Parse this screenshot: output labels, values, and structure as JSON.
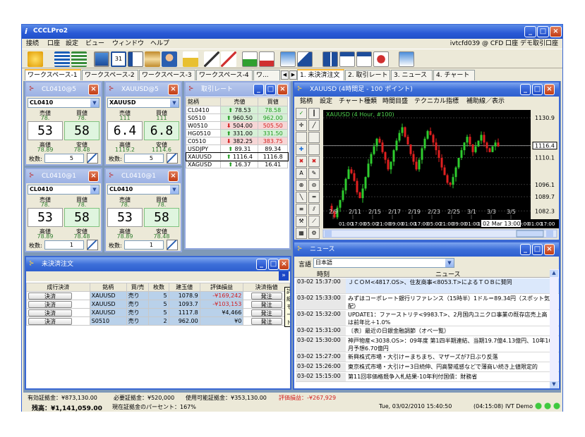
{
  "app": {
    "title": "CCCLPro2",
    "account_info": "ivtcfd039 @ CFD 口座 デモ取引口座"
  },
  "menu": [
    "接続",
    "口座",
    "設定",
    "ビュー",
    "ウィンドウ",
    "ヘルプ"
  ],
  "workspace_tabs": [
    "ワークスペース-1",
    "ワークスペース-2",
    "ワークスペース-3",
    "ワークスペース-4",
    "ワ..."
  ],
  "panel_tabs": [
    "1. 未決済注文",
    "2. 取引レート",
    "3. ニュース",
    "4. チャート"
  ],
  "quote_panels": [
    {
      "title": "CL0410@5",
      "symbol": "CL0410",
      "sell_label": "売値",
      "buy_label": "買値",
      "sell_small": "78.",
      "buy_small": "78.",
      "sell_big": "53",
      "buy_big": "58",
      "high_label": "高値",
      "low_label": "安値",
      "high": "78.89",
      "low": "78.48",
      "qty_label": "枚数:",
      "qty": "5"
    },
    {
      "title": "XAUUSD@5",
      "symbol": "XAUUSD",
      "sell_label": "売値",
      "buy_label": "買値",
      "sell_small": "111",
      "buy_small": "111",
      "sell_big": "6.4",
      "buy_big": "6.8",
      "high_label": "高値",
      "low_label": "安値",
      "high": "1119.2",
      "low": "1114.6",
      "qty_label": "枚数:",
      "qty": "5"
    },
    {
      "title": "CL0410@1",
      "symbol": "CL0410",
      "sell_label": "売値",
      "buy_label": "買値",
      "sell_small": "78.",
      "buy_small": "78.",
      "sell_big": "53",
      "buy_big": "58",
      "high_label": "高値",
      "low_label": "安値",
      "high": "78.89",
      "low": "78.48",
      "qty_label": "枚数:",
      "qty": "1"
    },
    {
      "title": "CL0410@1",
      "symbol": "CL0410",
      "sell_label": "売値",
      "buy_label": "買値",
      "sell_small": "78.",
      "buy_small": "78.",
      "sell_big": "53",
      "buy_big": "58",
      "high_label": "高値",
      "low_label": "安値",
      "high": "78.89",
      "low": "78.48",
      "qty_label": "枚数:",
      "qty": "1"
    }
  ],
  "rates": {
    "title": "取引レート",
    "headers": [
      "銘柄",
      "売値",
      "買値"
    ],
    "rows": [
      {
        "sym": "CL0410",
        "sell": "78.53",
        "buy": "78.58",
        "dir": "up"
      },
      {
        "sym": "S0510",
        "sell": "960.50",
        "buy": "962.00",
        "dir": "up"
      },
      {
        "sym": "W0510",
        "sell": "504.00",
        "buy": "505.50",
        "dir": "down"
      },
      {
        "sym": "HG0510",
        "sell": "331.00",
        "buy": "331.50",
        "dir": "up"
      },
      {
        "sym": "C0510",
        "sell": "382.25",
        "buy": "383.75",
        "dir": "down"
      },
      {
        "sym": "USDJPY",
        "sell": "89.31",
        "buy": "89.34",
        "dir": "up"
      },
      {
        "sym": "XAUUSD",
        "sell": "1116.4",
        "buy": "1116.8",
        "dir": "up"
      },
      {
        "sym": "XAGUSD",
        "sell": "16.37",
        "buy": "16.41",
        "dir": "up"
      }
    ]
  },
  "chart": {
    "title": "XAUUSD (4時間足 - 100 ポイント)",
    "menu": [
      "銘柄",
      "設定",
      "チャート種類",
      "時間目盛",
      "テクニカル指標",
      "補助線／表示"
    ],
    "label": "XAUUSD (4 Hour, #100)",
    "y_ticks": [
      "1130.9",
      "1116.4",
      "1110.1",
      "1096.1",
      "1089.7",
      "1082.3"
    ],
    "date_ticks": [
      "2/9",
      "2/11",
      "2/15",
      "2/17",
      "2/19",
      "2/23",
      "2/25",
      "3/1",
      "3/3",
      "3/5"
    ],
    "time_ticks": [
      "01:00",
      "17:00",
      "05:00",
      "21:00",
      "09:00",
      "01:00",
      "17:00",
      "05:00",
      "21:00",
      "09:00",
      "01:00",
      "17:00",
      "05:00",
      "21:00",
      "09:00",
      "01:00",
      "17:00"
    ],
    "current_price": "1116.4",
    "cursor_time": "02 Mar 13:00"
  },
  "chart_data": {
    "type": "candlestick",
    "title": "XAUUSD (4 Hour, #100)",
    "ylim": [
      1078,
      1135
    ],
    "close_series": [
      1085,
      1082,
      1079,
      1084,
      1088,
      1093,
      1099,
      1104,
      1102,
      1098,
      1092,
      1089,
      1094,
      1100,
      1107,
      1112,
      1116,
      1120,
      1118,
      1113,
      1109,
      1104,
      1108,
      1114,
      1119,
      1123,
      1126,
      1121,
      1117,
      1112,
      1108,
      1104,
      1109,
      1115,
      1120,
      1124,
      1122,
      1118,
      1114,
      1110,
      1105,
      1101,
      1097,
      1096,
      1100,
      1105,
      1110,
      1114,
      1118,
      1121,
      1117,
      1113,
      1116,
      1119,
      1122,
      1118,
      1115,
      1113,
      1116,
      1118,
      1116
    ]
  },
  "news": {
    "title": "ニュース",
    "lang_label": "言語",
    "lang": "日本語",
    "headers": [
      "時刻",
      "ニュース"
    ],
    "rows": [
      {
        "time": "03-02 15:37:00",
        "text": "ＪＣＯＭ&lt;4817.OS&gt;、住友商事&lt;8053.T&gt;によるＴＯＢに賛同"
      },
      {
        "time": "03-02 15:33:00",
        "text": "みずほコーポレート銀行リファレンス（15時半）1ドル＝89.34円（スポット気配）"
      },
      {
        "time": "03-02 15:32:00",
        "text": "UPDATE1：ファーストリテ&lt;9983.T&gt;、2月国内ユニクロ事業の既存店売上高は前年比＋1.0%"
      },
      {
        "time": "03-02 15:31:00",
        "text": "〔表〕最近の日銀金融調節（オペ一覧）"
      },
      {
        "time": "03-02 15:30:00",
        "text": "神戸物産&lt;3038.OS&gt;：09年度 第1四半期連結、当期19.7億4.13億円、10年10月予想6.70億円"
      },
      {
        "time": "03-02 15:27:00",
        "text": "新興株式市場・大引け＝まちまち、マザーズが7日ぶり反落"
      },
      {
        "time": "03-02 15:26:00",
        "text": "東京株式市場・大引け＝3日続伸、円高警戒感などで薄商い続き上値限定的"
      },
      {
        "time": "03-02 15:15:00",
        "text": "第11回非価格競争入札結果-10年利付国債：財務省"
      }
    ]
  },
  "orders": {
    "title": "未決済注文",
    "tooltip": "詳細モード",
    "headers": [
      "成行決済",
      "銘柄",
      "買/売",
      "枚数",
      "建玉値",
      "評価損益",
      "決済指値"
    ],
    "rows": [
      {
        "btn": "決済",
        "sym": "XAUUSD",
        "side": "売り",
        "qty": "5",
        "price": "1078.9",
        "pl": "-¥169,242",
        "limit": "発注",
        "neg": true,
        "hl": true
      },
      {
        "btn": "決済",
        "sym": "XAUUSD",
        "side": "売り",
        "qty": "5",
        "price": "1093.7",
        "pl": "-¥103,153",
        "limit": "発注",
        "neg": true,
        "hl": true
      },
      {
        "btn": "決済",
        "sym": "XAUUSD",
        "side": "売り",
        "qty": "5",
        "price": "1117.8",
        "pl": "¥4,466",
        "limit": "発注",
        "neg": false,
        "hl": true
      },
      {
        "btn": "決済",
        "sym": "S0510",
        "side": "売り",
        "qty": "2",
        "price": "962.00",
        "pl": "¥0",
        "limit": "発注",
        "neg": false,
        "hl": true
      }
    ]
  },
  "status": {
    "valid_margin": "有効証拠金：¥873,130.00",
    "req_margin": "必要証拠金：¥520,000",
    "avail_margin": "使用可能証拠金：¥353,130.00",
    "pl": "評価損益：-¥267,929",
    "balance": "残高：¥1,141,059.00",
    "margin_pct": "現在証拠金のパーセント：167%",
    "datetime": "Tue, 03/02/2010 15:40:50",
    "clock": "(04:15:08)",
    "mode": "IVT Demo"
  },
  "colors": {
    "xp_blue": "#3a68d4",
    "up": "#1f9a1f",
    "down": "#d21e1e",
    "chart_bg": "#000000"
  }
}
